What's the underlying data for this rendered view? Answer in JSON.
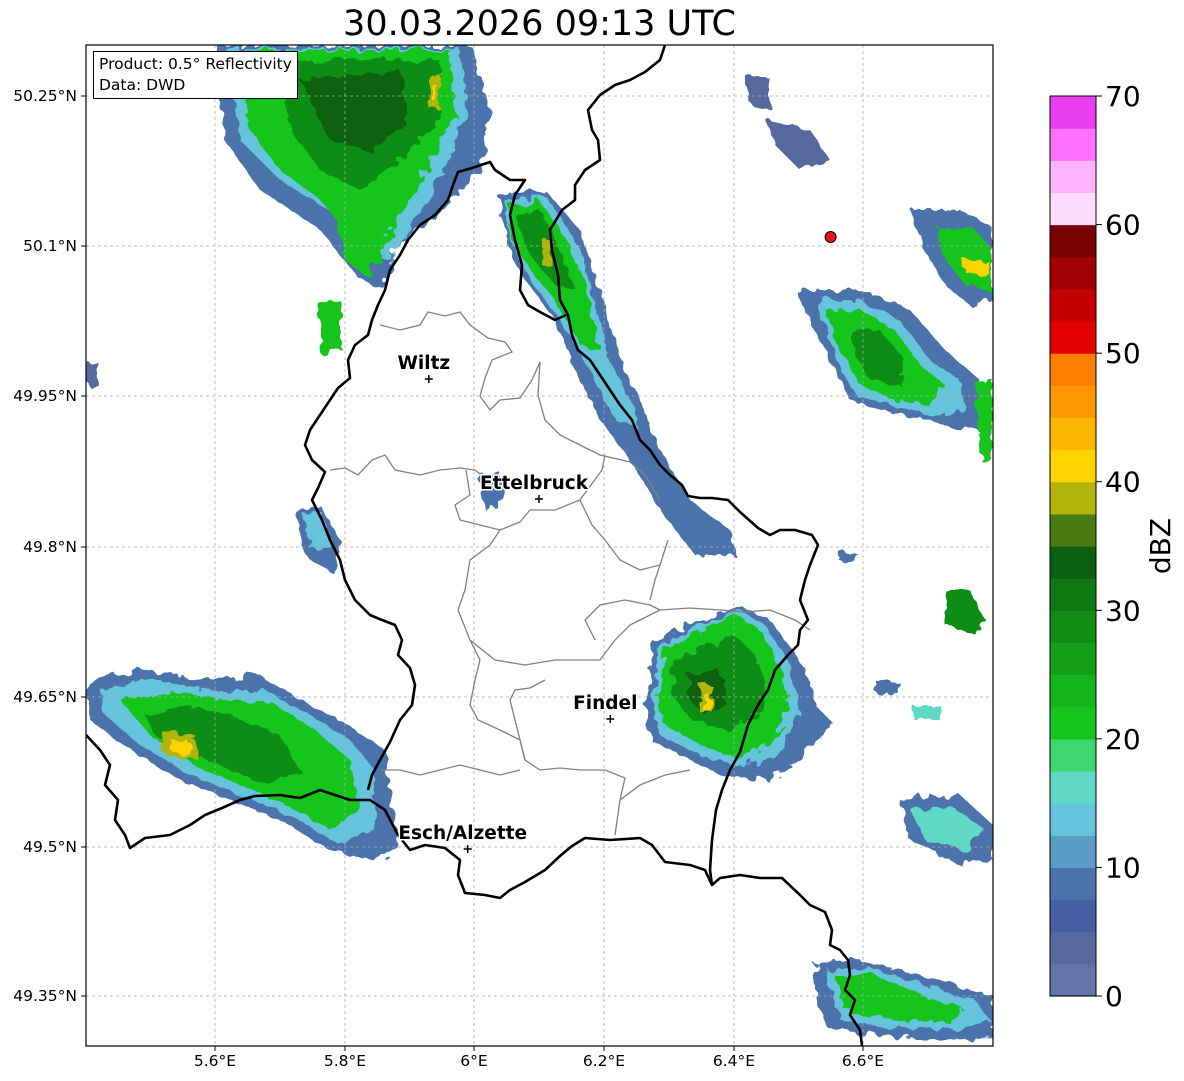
{
  "title": "30.03.2026 09:13 UTC",
  "info": {
    "product": "Product: 0.5° Reflectivity",
    "data": "Data: DWD"
  },
  "axes": {
    "lon_ticks": [
      "5.6°E",
      "5.8°E",
      "6°E",
      "6.2°E",
      "6.4°E",
      "6.6°E"
    ],
    "lat_ticks": [
      "50.25°N",
      "50.1°N",
      "49.95°N",
      "49.8°N",
      "49.65°N",
      "49.5°N",
      "49.35°N"
    ]
  },
  "cities": [
    {
      "name": "Wiltz",
      "lon": 5.93,
      "lat": 49.967
    },
    {
      "name": "Ettelbruck",
      "lon": 6.1,
      "lat": 49.847
    },
    {
      "name": "Findel",
      "lon": 6.21,
      "lat": 49.627
    },
    {
      "name": "Esch/Alzette",
      "lon": 5.99,
      "lat": 49.497
    }
  ],
  "marker": {
    "lon": 6.55,
    "lat": 50.109,
    "color": "#e8141e"
  },
  "colorbar": {
    "label": "dBZ",
    "min": 0,
    "max": 70,
    "tick_labels": [
      "0",
      "10",
      "20",
      "30",
      "40",
      "50",
      "60",
      "70"
    ],
    "colors": [
      "#6474a6",
      "#57699f",
      "#465fa2",
      "#4b72aa",
      "#5b9cc6",
      "#66c3dc",
      "#5fd8c6",
      "#3dd76f",
      "#13c51d",
      "#14b51a",
      "#139f17",
      "#118d15",
      "#0e7913",
      "#0a600f",
      "#4a7a12",
      "#b0b40c",
      "#fed300",
      "#fdb500",
      "#fd9900",
      "#fd7e00",
      "#e20000",
      "#c40000",
      "#a20000",
      "#7b0000",
      "#fddcfd",
      "#fdb3fd",
      "#fd71fd",
      "#eb3df0"
    ]
  }
}
